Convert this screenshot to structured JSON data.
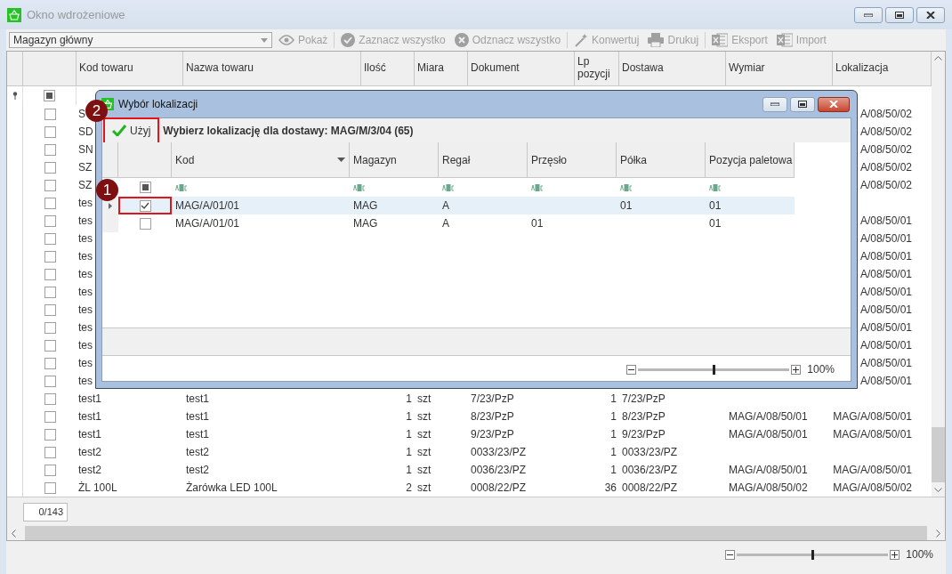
{
  "window": {
    "title": "Okno wdrożeniowe",
    "active": false
  },
  "toolbar": {
    "combo": {
      "value": "Magazyn główny"
    },
    "buttons": [
      {
        "kind": "eye",
        "label": "Pokaż",
        "disabled": true
      },
      {
        "kind": "check",
        "label": "Zaznacz wszystko",
        "disabled": true
      },
      {
        "kind": "cross",
        "label": "Odznacz wszystko",
        "disabled": true
      },
      {
        "kind": "wand",
        "label": "Konwertuj",
        "disabled": true
      },
      {
        "kind": "printer",
        "label": "Drukuj",
        "disabled": true
      },
      {
        "kind": "excel",
        "label": "Eksport",
        "disabled": true
      },
      {
        "kind": "excel",
        "label": "Import",
        "disabled": true
      }
    ]
  },
  "table": {
    "select_all": {
      "indeterminate": true
    },
    "columns": [
      "Kod towaru",
      "Nazwa towaru",
      "Ilość",
      "Miara",
      "Dokument",
      "Lp pozycji",
      "Dostawa",
      "Wymiar",
      "Lokalizacja"
    ],
    "rows": [
      {
        "checked": false,
        "kod": "S",
        "lokalizacja": "A/08/50/02"
      },
      {
        "checked": false,
        "kod": "SD",
        "lokalizacja": "A/08/50/02"
      },
      {
        "checked": false,
        "kod": "SN",
        "lokalizacja": "A/08/50/02"
      },
      {
        "checked": false,
        "kod": "SZ",
        "lokalizacja": "A/08/50/02"
      },
      {
        "checked": false,
        "kod": "SZ",
        "lokalizacja": "A/08/50/02"
      },
      {
        "checked": false,
        "kod": "tes"
      },
      {
        "checked": false,
        "kod": "tes",
        "lokalizacja": "A/08/50/01"
      },
      {
        "checked": false,
        "kod": "tes",
        "lokalizacja": "A/08/50/01"
      },
      {
        "checked": false,
        "kod": "tes",
        "lokalizacja": "A/08/50/01"
      },
      {
        "checked": false,
        "kod": "tes",
        "lokalizacja": "A/08/50/01"
      },
      {
        "checked": false,
        "kod": "tes",
        "lokalizacja": "A/08/50/01"
      },
      {
        "checked": false,
        "kod": "tes",
        "lokalizacja": "A/08/50/01"
      },
      {
        "checked": false,
        "kod": "tes",
        "lokalizacja": "A/08/50/01"
      },
      {
        "checked": false,
        "kod": "tes",
        "lokalizacja": "A/08/50/01"
      },
      {
        "checked": false,
        "kod": "tes",
        "lokalizacja": "A/08/50/01"
      },
      {
        "checked": false,
        "kod": "tes",
        "lokalizacja": "A/08/50/01"
      },
      {
        "checked": false,
        "kod": "test1",
        "nazwa": "test1",
        "ilosc": "1",
        "miara": "szt",
        "dokument": "7/23/PzP",
        "lp": "1",
        "dostawa": "7/23/PzP"
      },
      {
        "checked": false,
        "kod": "test1",
        "nazwa": "test1",
        "ilosc": "1",
        "miara": "szt",
        "dokument": "8/23/PzP",
        "lp": "1",
        "dostawa": "8/23/PzP",
        "wymiar": "MAG/A/08/50/01",
        "lokalizacja": "MAG/A/08/50/01"
      },
      {
        "checked": false,
        "kod": "test1",
        "nazwa": "test1",
        "ilosc": "1",
        "miara": "szt",
        "dokument": "9/23/PzP",
        "lp": "1",
        "dostawa": "9/23/PzP",
        "wymiar": "MAG/A/08/50/01",
        "lokalizacja": "MAG/A/08/50/01"
      },
      {
        "checked": false,
        "kod": "test2",
        "nazwa": "test2",
        "ilosc": "1",
        "miara": "szt",
        "dokument": "0033/23/PZ",
        "lp": "1",
        "dostawa": "0033/23/PZ"
      },
      {
        "checked": false,
        "kod": "test2",
        "nazwa": "test2",
        "ilosc": "1",
        "miara": "szt",
        "dokument": "0036/23/PZ",
        "lp": "1",
        "dostawa": "0036/23/PZ",
        "wymiar": "MAG/A/08/50/01",
        "lokalizacja": "MAG/A/08/50/01"
      },
      {
        "checked": false,
        "kod": "ŻL 100L",
        "nazwa": "Żarówka LED 100L",
        "ilosc": "2",
        "miara": "szt",
        "dokument": "0008/22/PZ",
        "lp": "36",
        "dostawa": "0008/22/PZ",
        "wymiar": "MAG/A/08/50/02",
        "lokalizacja": "MAG/A/08/50/02"
      }
    ]
  },
  "counter": "0/143",
  "zoom": {
    "level": 0.5,
    "reading": "100%"
  },
  "dialog": {
    "title": "Wybór lokalizacji",
    "use_button": {
      "label": "Użyj",
      "highlighted": true
    },
    "heading": "Wybierz lokalizację dla dostawy: MAG/M/3/04 (65)",
    "select_all": {
      "indeterminate": true
    },
    "columns": [
      "Kod",
      "Magazyn",
      "Regał",
      "Przęsło",
      "Półka",
      "Pozycja paletowa"
    ],
    "rows": [
      {
        "selected": true,
        "checked": true,
        "highlighted": true,
        "cells": [
          "MAG/A/01/01",
          "MAG",
          "A",
          "",
          "01",
          "01"
        ]
      },
      {
        "selected": false,
        "checked": false,
        "highlighted": false,
        "cells": [
          "MAG/A/01/01",
          "MAG",
          "A",
          "01",
          "",
          "01"
        ]
      }
    ],
    "zoom": {
      "level": 0.5,
      "reading": "100%"
    }
  },
  "callouts": [
    {
      "number": "1"
    },
    {
      "number": "2"
    }
  ]
}
